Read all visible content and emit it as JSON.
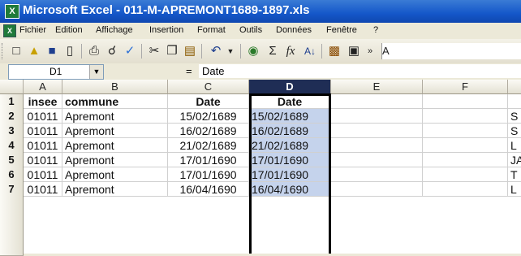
{
  "window": {
    "title": "Microsoft Excel - 011-M-APREMONT1689-1897.xls"
  },
  "menu": [
    "Fichier",
    "Edition",
    "Affichage",
    "Insertion",
    "Format",
    "Outils",
    "Données",
    "Fenêtre",
    "?"
  ],
  "formula_bar": {
    "name_box": "D1",
    "equals": "=",
    "value": "Date"
  },
  "columns": [
    "A",
    "B",
    "C",
    "D",
    "E",
    "F"
  ],
  "selected_column": "D",
  "rows": [
    {
      "num": "1",
      "cells": [
        "insee",
        "commune",
        "Date",
        "Date",
        "",
        "",
        ""
      ]
    },
    {
      "num": "2",
      "cells": [
        "01011",
        "Apremont",
        "15/02/1689",
        "15/02/1689",
        "",
        "",
        "S"
      ]
    },
    {
      "num": "3",
      "cells": [
        "01011",
        "Apremont",
        "16/02/1689",
        "16/02/1689",
        "",
        "",
        "S"
      ]
    },
    {
      "num": "4",
      "cells": [
        "01011",
        "Apremont",
        "21/02/1689",
        "21/02/1689",
        "",
        "",
        "L"
      ]
    },
    {
      "num": "5",
      "cells": [
        "01011",
        "Apremont",
        "17/01/1690",
        "17/01/1690",
        "",
        "",
        "JA"
      ]
    },
    {
      "num": "6",
      "cells": [
        "01011",
        "Apremont",
        "17/01/1690",
        "17/01/1690",
        "",
        "",
        "T"
      ]
    },
    {
      "num": "7",
      "cells": [
        "01011",
        "Apremont",
        "16/04/1690",
        "16/04/1690",
        "",
        "",
        "L"
      ]
    }
  ],
  "colors": {
    "title_bar": "#1457c9",
    "selection": "#c5d3ec",
    "selected_header": "#1f2d55"
  },
  "toolbar_icons": [
    "new-icon",
    "open-icon",
    "save-icon",
    "permission-icon",
    "print-icon",
    "print-preview-icon",
    "spelling-icon",
    "cut-icon",
    "copy-icon",
    "paste-icon",
    "undo-icon",
    "hyperlink-icon",
    "autosum-icon",
    "function-icon",
    "sort-ascending-icon",
    "chart-wizard-icon",
    "help-icon"
  ]
}
